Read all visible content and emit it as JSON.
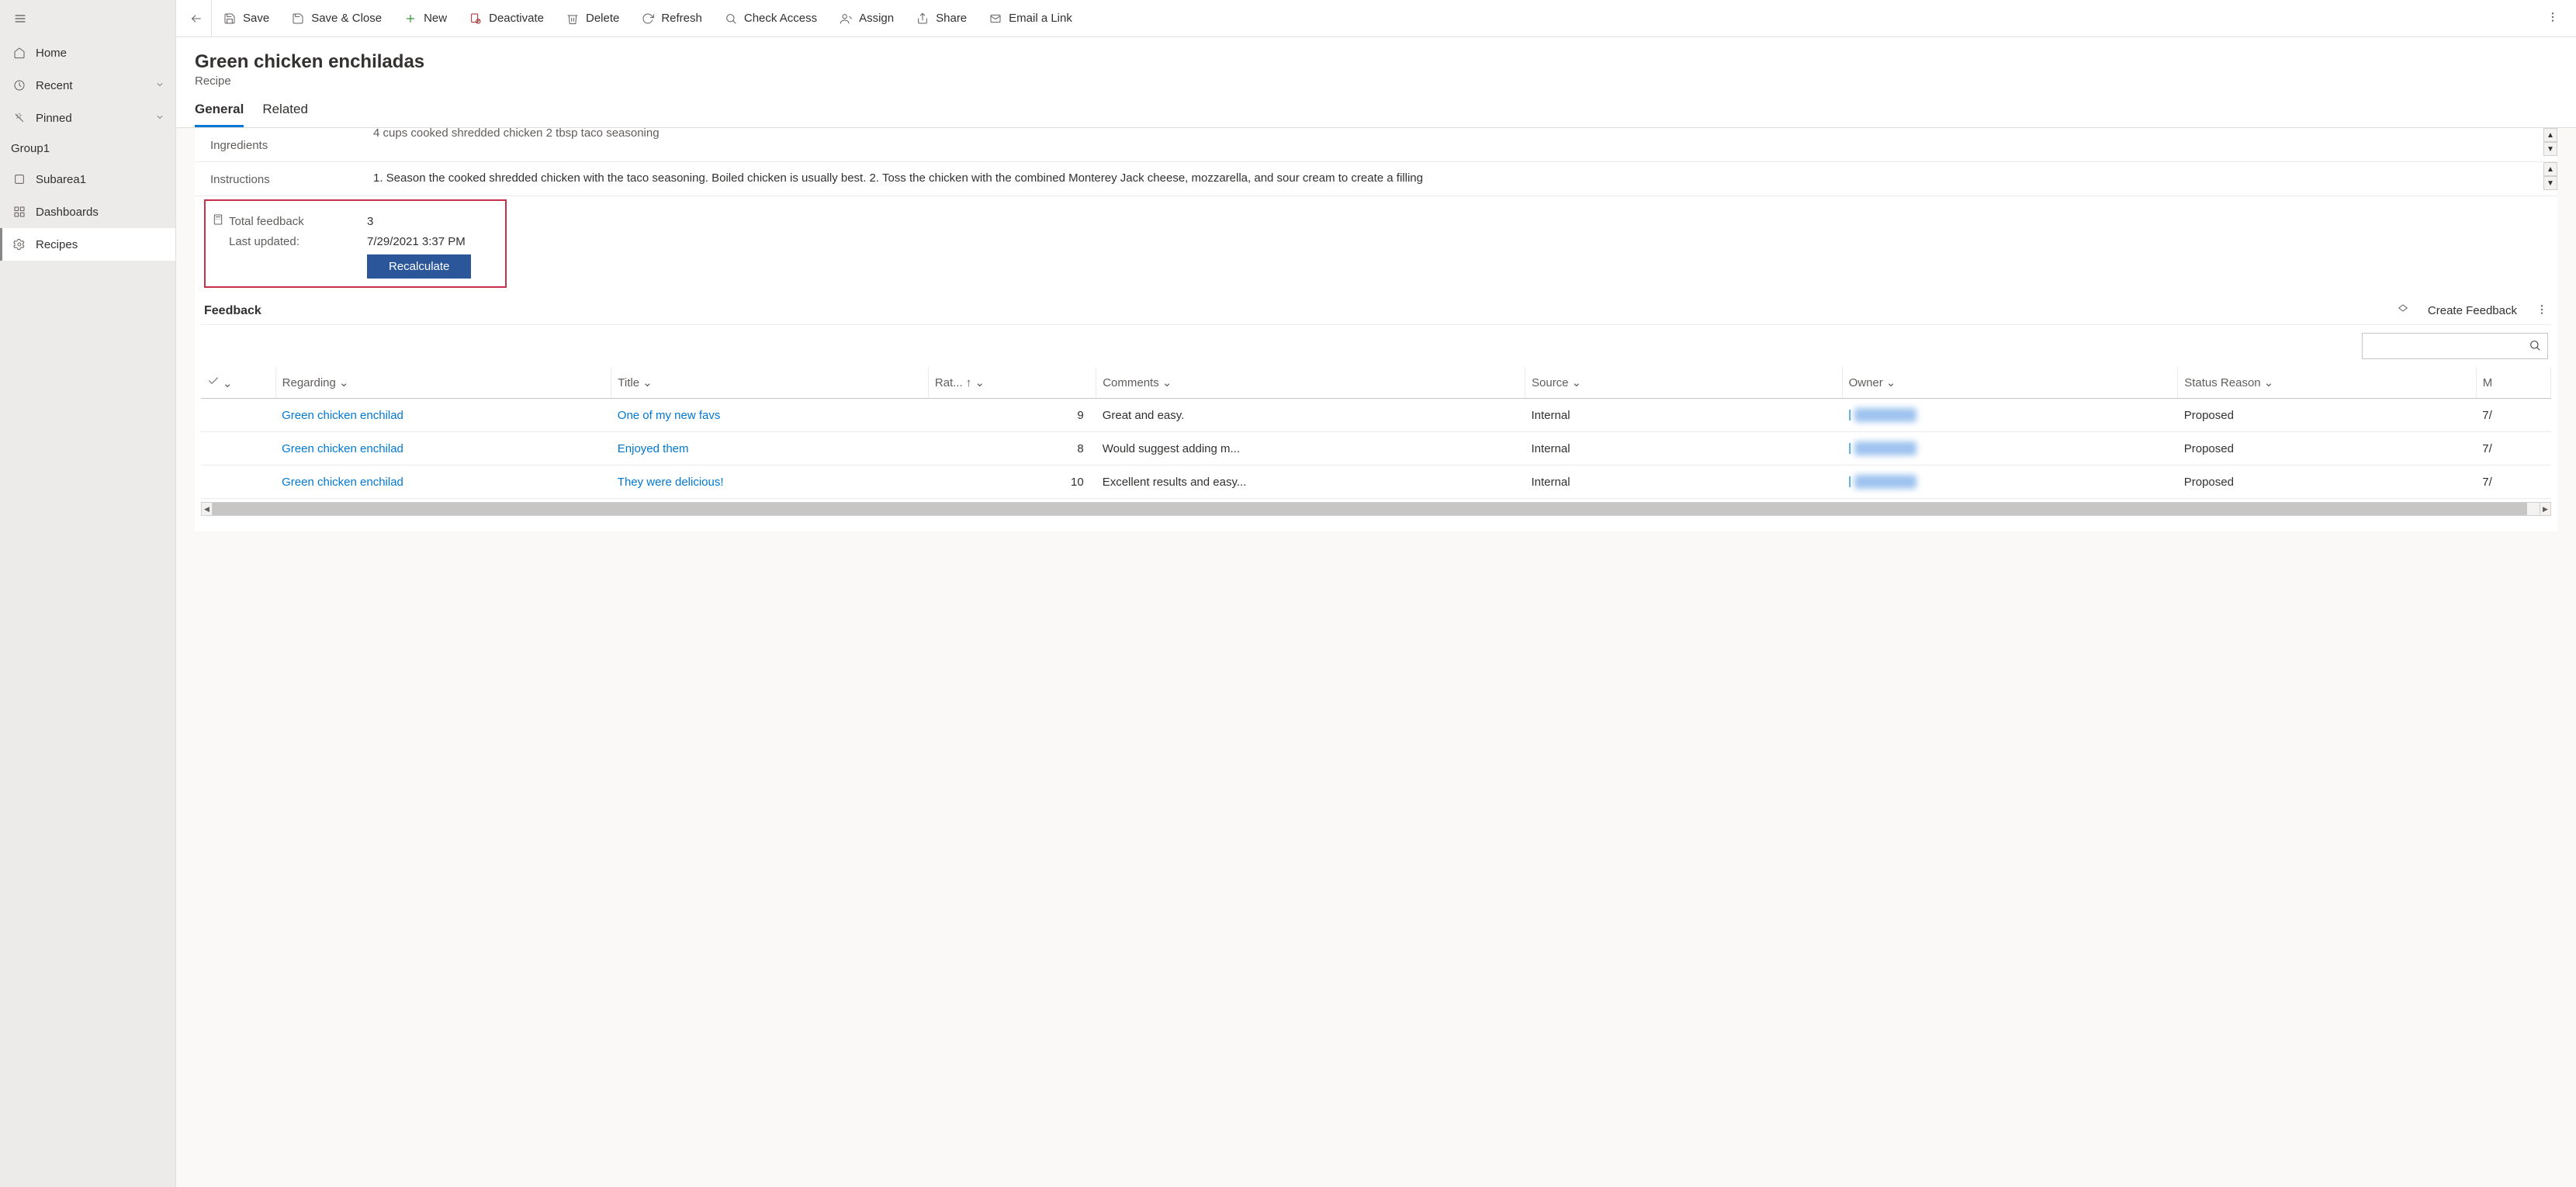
{
  "sidebar": {
    "items": [
      {
        "label": "Home"
      },
      {
        "label": "Recent"
      },
      {
        "label": "Pinned"
      }
    ],
    "group_label": "Group1",
    "group_items": [
      {
        "label": "Subarea1"
      },
      {
        "label": "Dashboards"
      },
      {
        "label": "Recipes"
      }
    ]
  },
  "commands": {
    "save": "Save",
    "save_close": "Save & Close",
    "new": "New",
    "deactivate": "Deactivate",
    "delete": "Delete",
    "refresh": "Refresh",
    "check_access": "Check Access",
    "assign": "Assign",
    "share": "Share",
    "email_link": "Email a Link"
  },
  "record": {
    "title": "Green chicken enchiladas",
    "entity": "Recipe"
  },
  "tabs": [
    {
      "label": "General",
      "active": true
    },
    {
      "label": "Related",
      "active": false
    }
  ],
  "fields": {
    "ingredients_label": "Ingredients",
    "ingredients_text": "4 cups cooked shredded chicken\n2 tbsp taco seasoning",
    "instructions_label": "Instructions",
    "instructions_text": "1. Season the cooked shredded chicken with the taco seasoning. Boiled chicken is usually best.\n2. Toss the chicken with the combined Monterey Jack cheese, mozzarella, and sour cream to create a filling"
  },
  "rollup": {
    "total_label": "Total feedback",
    "total_value": "3",
    "last_updated_label": "Last updated:",
    "last_updated_value": "7/29/2021 3:37 PM",
    "recalc_label": "Recalculate"
  },
  "subgrid": {
    "title": "Feedback",
    "create_label": "Create Feedback",
    "columns": {
      "regarding": "Regarding",
      "title": "Title",
      "rating": "Rat...",
      "comments": "Comments",
      "source": "Source",
      "owner": "Owner",
      "status_reason": "Status Reason",
      "m": "M"
    },
    "rows": [
      {
        "regarding": "Green chicken enchilad",
        "title": "One of my new favs",
        "rating": "9",
        "comments": "Great and easy.",
        "source": "Internal",
        "status": "Proposed",
        "m": "7/"
      },
      {
        "regarding": "Green chicken enchilad",
        "title": "Enjoyed them",
        "rating": "8",
        "comments": "Would suggest adding m...",
        "source": "Internal",
        "status": "Proposed",
        "m": "7/"
      },
      {
        "regarding": "Green chicken enchilad",
        "title": "They were delicious!",
        "rating": "10",
        "comments": "Excellent results and easy...",
        "source": "Internal",
        "status": "Proposed",
        "m": "7/"
      }
    ]
  }
}
